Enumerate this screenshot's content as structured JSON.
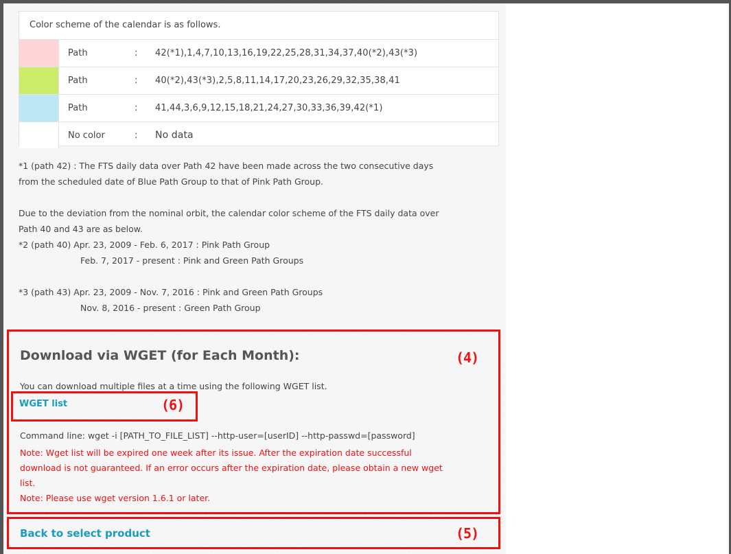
{
  "legend": {
    "title": "Color scheme of the calendar is as follows.",
    "rows": [
      {
        "color": "#ffd5d8",
        "label": "Path",
        "sep": ":",
        "value": "42(*1),1,4,7,10,13,16,19,22,25,28,31,34,37,40(*2),43(*3)"
      },
      {
        "color": "#cdec6a",
        "label": "Path",
        "sep": ":",
        "value": "40(*2),43(*3),2,5,8,11,14,17,20,23,26,29,32,35,38,41"
      },
      {
        "color": "#bde7f5",
        "label": "Path",
        "sep": ":",
        "value": "41,44,3,6,9,12,15,18,21,24,27,30,33,36,39,42(*1)"
      },
      {
        "color": "#ffffff",
        "label": "No color",
        "sep": ":",
        "value": "No data"
      }
    ]
  },
  "notes": {
    "note1_line1": "*1 (path 42) : The FTS daily data over Path 42 have been made across the two consecutive days",
    "note1_line2": "from the scheduled date of Blue Path Group to that of Pink Path Group.",
    "dev_line1": "Due to the deviation from the nominal orbit, the calendar color scheme of the FTS daily data over",
    "dev_line2": "Path 40 and 43 are as below.",
    "note2_line1": "*2 (path 40) Apr. 23, 2009 - Feb. 6, 2017 : Pink Path Group",
    "note2_line2": "Feb. 7, 2017 - present : Pink and Green Path Groups",
    "note3_line1": "*3 (path 43) Apr. 23, 2009 - Nov. 7, 2016 : Pink and Green Path Groups",
    "note3_line2": "Nov. 8, 2016 - present : Green Path Group"
  },
  "wget": {
    "title": "Download via WGET (for Each Month):",
    "description": "You can download multiple files at a time using the following WGET list.",
    "link_label": "WGET list",
    "command": "Command line: wget -i [PATH_TO_FILE_LIST] --http-user=[userID] --http-passwd=[password]",
    "warn1_line1": "Note: Wget list will be expired one week after its issue. After the expiration date successful",
    "warn1_line2": "download is not guaranteed. If an error occurs after the expiration date, please obtain a new wget",
    "warn1_line3": "list.",
    "warn2": "Note: Please use wget version 1.6.1 or later."
  },
  "back_link": "Back to select product",
  "markers": {
    "m4": "(4)",
    "m5": "(5)",
    "m6": "(6)"
  },
  "colors": {
    "accent_link": "#1a9bbf",
    "warning": "#ee1111",
    "annotation": "#ee1111"
  }
}
